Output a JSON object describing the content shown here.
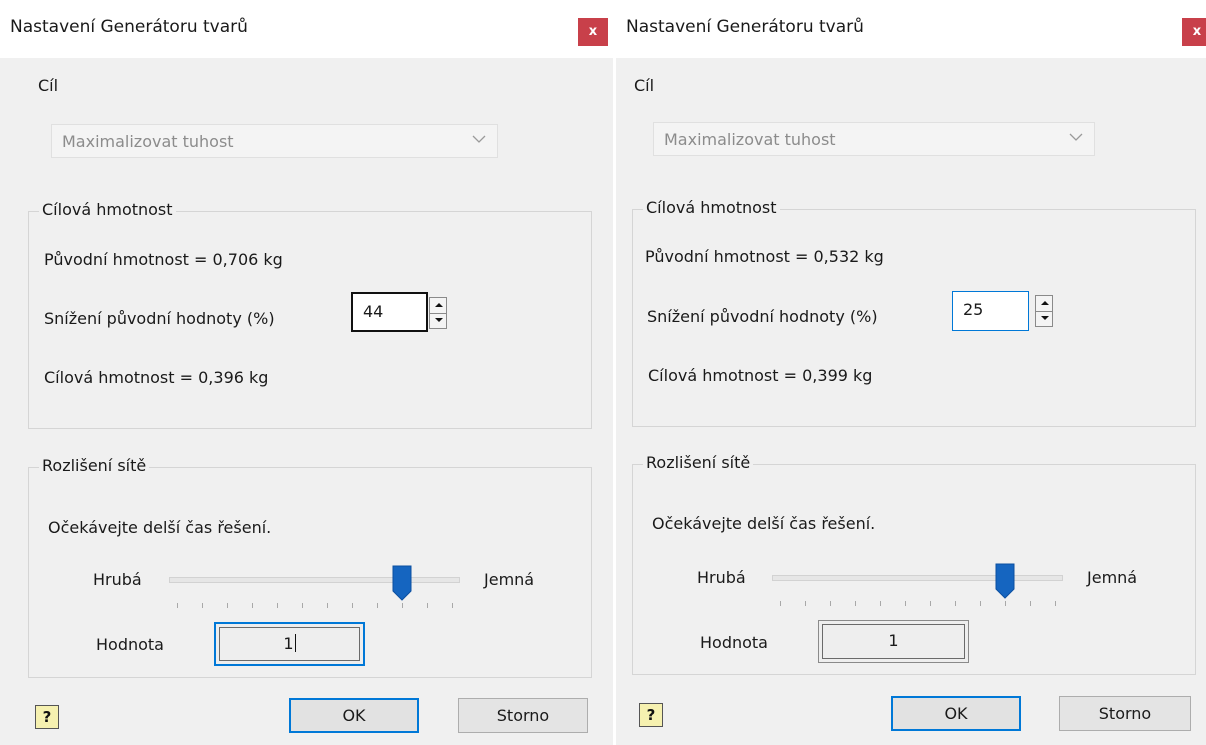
{
  "dialogs": [
    {
      "title": "Nastavení Generátoru tvarů",
      "close_label": "x",
      "goal": {
        "label": "Cíl",
        "selected": "Maximalizovat tuhost",
        "icon": "chevron-down-icon"
      },
      "target_mass": {
        "group_title": "Cílová hmotnost",
        "original_mass": "Původní hmotnost = 0,706 kg",
        "reduction_label": "Snížení původní hodnoty (%)",
        "reduction_value": "44",
        "result": "Cílová hmotnost = 0,396 kg"
      },
      "mesh": {
        "group_title": "Rozlišení sítě",
        "note": "Očekávejte delší čas řešení.",
        "min_label": "Hrubá",
        "max_label": "Jemná",
        "slider_level": 0.8,
        "value_label": "Hodnota",
        "value": "1"
      },
      "buttons": {
        "help_icon": "help-icon",
        "help_glyph": "?",
        "ok": "OK",
        "cancel": "Storno"
      },
      "colors": {
        "close": "#c8404a",
        "focus": "#0078d7",
        "thumb": "#1565c0"
      }
    },
    {
      "title": "Nastavení Generátoru tvarů",
      "close_label": "x",
      "goal": {
        "label": "Cíl",
        "selected": "Maximalizovat tuhost",
        "icon": "chevron-down-icon"
      },
      "target_mass": {
        "group_title": "Cílová hmotnost",
        "original_mass": "Původní hmotnost = 0,532 kg",
        "reduction_label": "Snížení původní hodnoty (%)",
        "reduction_value": "25",
        "result": "Cílová hmotnost = 0,399 kg"
      },
      "mesh": {
        "group_title": "Rozlišení sítě",
        "note": "Očekávejte delší čas řešení.",
        "min_label": "Hrubá",
        "max_label": "Jemná",
        "slider_level": 0.8,
        "value_label": "Hodnota",
        "value": "1"
      },
      "buttons": {
        "help_icon": "help-icon",
        "help_glyph": "?",
        "ok": "OK",
        "cancel": "Storno"
      },
      "colors": {
        "close": "#c8404a",
        "focus": "#0078d7",
        "thumb": "#1565c0"
      }
    }
  ]
}
